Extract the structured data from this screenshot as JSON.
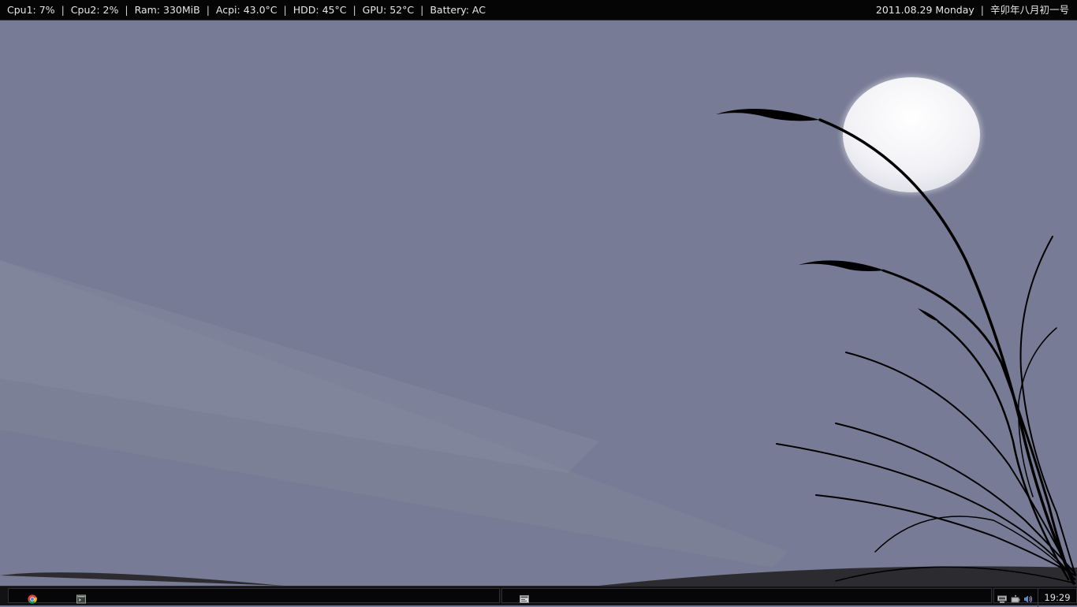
{
  "topbar": {
    "stats": [
      "Cpu1: 7%",
      "Cpu2: 2%",
      "Ram: 330MiB",
      "Acpi: 43.0°C",
      "HDD: 45°C",
      "GPU: 52°C",
      "Battery: AC"
    ],
    "date": "2011.08.29 Monday",
    "lunar_date": "辛卯年八月初一号"
  },
  "taskbar": {
    "launchers": [
      {
        "icon": "chrome-icon"
      },
      {
        "icon": "terminal-icon"
      }
    ],
    "window_buttons": [
      {
        "icon": "window-icon"
      }
    ],
    "tray_icons": [
      "network-icon",
      "battery-icon",
      "volume-icon"
    ],
    "clock": "19:29"
  },
  "theme": {
    "sky": "#777b95",
    "moon": "#f3f3f7",
    "grass": "#000000",
    "bar": "#050506"
  }
}
